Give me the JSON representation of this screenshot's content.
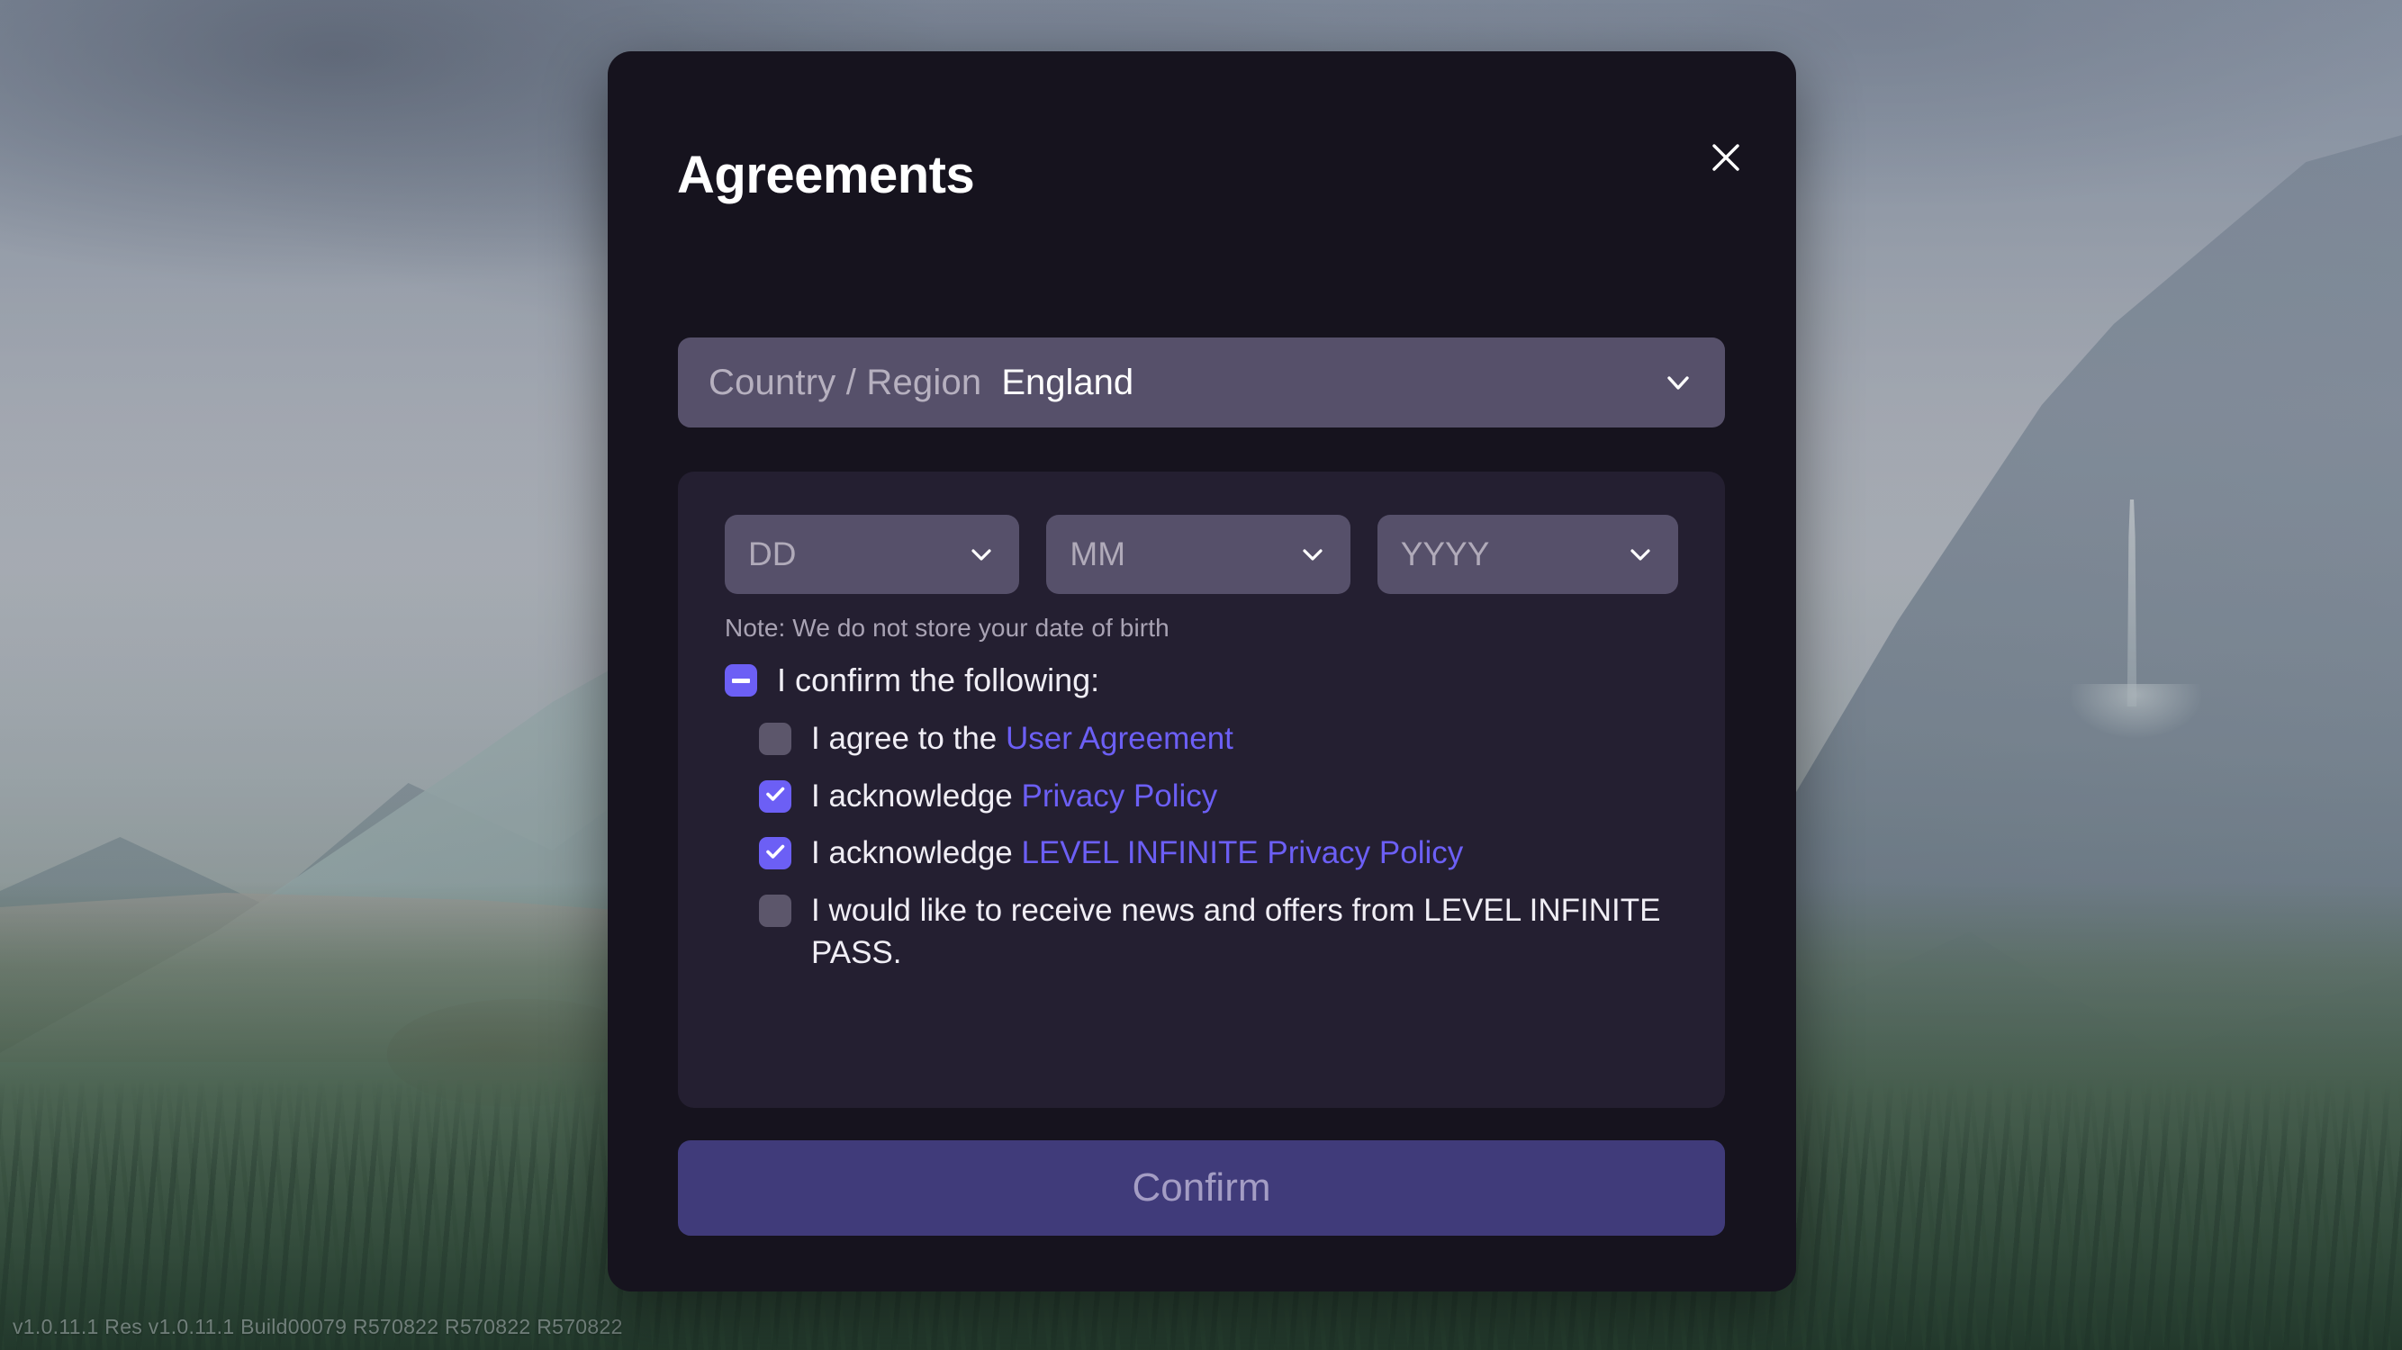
{
  "background": {
    "version_text": "v1.0.11.1 Res v1.0.11.1 Build00079 R570822 R570822 R570822"
  },
  "modal": {
    "title": "Agreements",
    "close_icon": "close-icon",
    "country": {
      "label": "Country / Region",
      "value": "England",
      "chevron_icon": "chevron-down-icon"
    },
    "date_of_birth": {
      "day_placeholder": "DD",
      "month_placeholder": "MM",
      "year_placeholder": "YYYY",
      "day_value": "",
      "month_value": "",
      "year_value": "",
      "chevron_icon": "chevron-down-icon",
      "note": "Note: We do not store your date of birth"
    },
    "agreements": {
      "parent": {
        "label": "I confirm the following:",
        "state": "indeterminate"
      },
      "items": [
        {
          "text_before": "I agree to the ",
          "link_text": "User Agreement",
          "text_after": "",
          "state": "unchecked"
        },
        {
          "text_before": "I acknowledge ",
          "link_text": "Privacy Policy",
          "text_after": "",
          "state": "checked"
        },
        {
          "text_before": "I acknowledge ",
          "link_text": "LEVEL INFINITE Privacy Policy",
          "text_after": "",
          "state": "checked"
        },
        {
          "text_before": "I would like to receive news and offers from LEVEL INFINITE PASS.",
          "link_text": "",
          "text_after": "",
          "state": "unchecked"
        }
      ]
    },
    "confirm": {
      "label": "Confirm",
      "enabled": false
    }
  },
  "colors": {
    "modal_bg": "#16131e",
    "panel_bg": "#241f31",
    "field_bg": "#56506a",
    "accent": "#6c5ff5",
    "link": "#6c5ff5",
    "confirm_bg": "#403b7a",
    "confirm_text": "#a49dc4",
    "checkbox_off": "#5c566b"
  }
}
